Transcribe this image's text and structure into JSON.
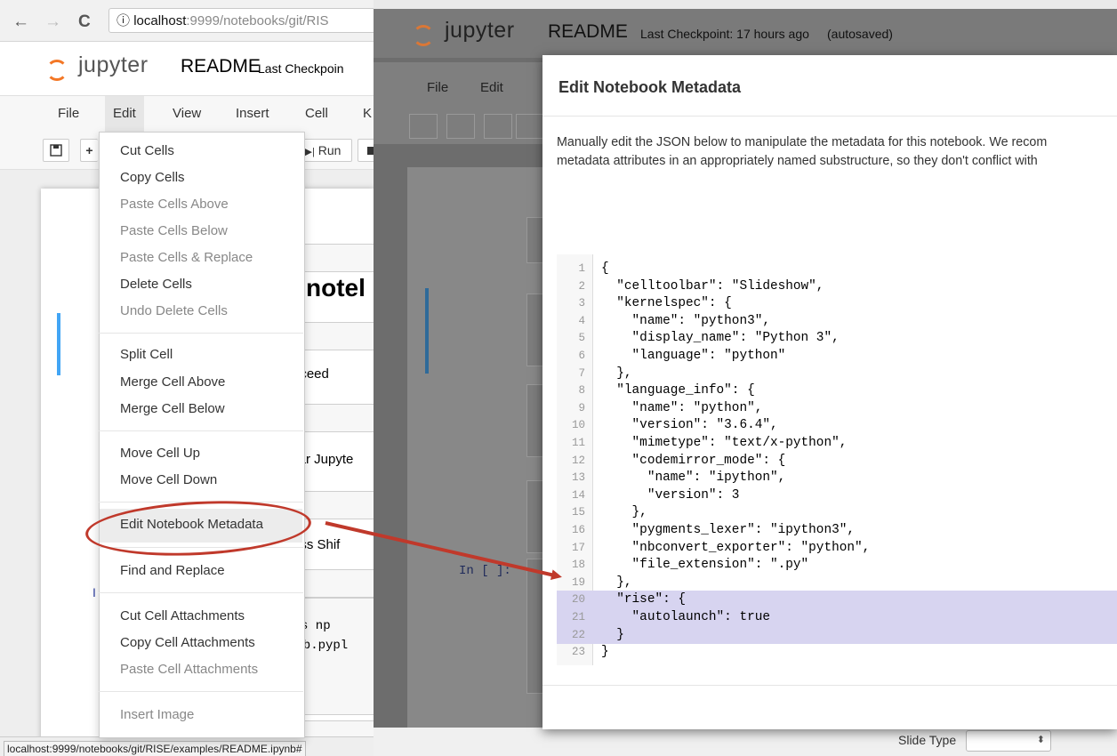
{
  "left_browser": {
    "nav": {
      "back": "←",
      "forward": "→",
      "reload": "C",
      "info": "ⓘ"
    },
    "url_host": "localhost",
    "url_rest": ":9999/notebooks/git/RIS",
    "logo_text": "jupyter",
    "notebook_name": "README",
    "checkpoint_text": "Last Checkpoin",
    "menu": [
      "File",
      "Edit",
      "View",
      "Insert",
      "Cell",
      "K"
    ],
    "toolbar": {
      "run_label": "Run"
    },
    "edit_menu": {
      "group1": [
        {
          "label": "Cut Cells",
          "enabled": true
        },
        {
          "label": "Copy Cells",
          "enabled": true
        },
        {
          "label": "Paste Cells Above",
          "enabled": false
        },
        {
          "label": "Paste Cells Below",
          "enabled": false
        },
        {
          "label": "Paste Cells & Replace",
          "enabled": false
        },
        {
          "label": "Delete Cells",
          "enabled": true
        },
        {
          "label": "Undo Delete Cells",
          "enabled": false
        }
      ],
      "group2": [
        {
          "label": "Split Cell",
          "enabled": true
        },
        {
          "label": "Merge Cell Above",
          "enabled": true
        },
        {
          "label": "Merge Cell Below",
          "enabled": true
        }
      ],
      "group3": [
        {
          "label": "Move Cell Up",
          "enabled": true
        },
        {
          "label": "Move Cell Down",
          "enabled": true
        }
      ],
      "group4": [
        {
          "label": "Edit Notebook Metadata",
          "enabled": true,
          "highlighted": true
        }
      ],
      "group5": [
        {
          "label": "Find and Replace",
          "enabled": true
        }
      ],
      "group6": [
        {
          "label": "Cut Cell Attachments",
          "enabled": true
        },
        {
          "label": "Copy Cell Attachments",
          "enabled": true
        },
        {
          "label": "Paste Cell Attachments",
          "enabled": false
        }
      ],
      "group7": [
        {
          "label": "Insert Image",
          "enabled": false
        }
      ]
    },
    "peek_text": {
      "heading": "notel",
      "proceed": "roceed",
      "jupyter": "ular Jupyte",
      "press": "ress Shif",
      "np": "s np",
      "pyplot": "lib.pypl",
      "prompt": "I"
    },
    "status_url": "localhost:9999/notebooks/git/RISE/examples/README.ipynb#"
  },
  "right_browser": {
    "logo_text": "jupyter",
    "notebook_name": "README",
    "checkpoint_text": "Last Checkpoint: 17 hours ago",
    "autosave_text": "(autosaved)",
    "menu": [
      "File",
      "Edit"
    ],
    "peek_prompt": "In [ ]:",
    "slide_type_label": "Slide Type"
  },
  "modal": {
    "title": "Edit Notebook Metadata",
    "desc_line1": "Manually edit the JSON below to manipulate the metadata for this notebook. We recom",
    "desc_line2": "metadata attributes in an appropriately named substructure, so they don't conflict with",
    "code_lines": [
      "{",
      "  \"celltoolbar\": \"Slideshow\",",
      "  \"kernelspec\": {",
      "    \"name\": \"python3\",",
      "    \"display_name\": \"Python 3\",",
      "    \"language\": \"python\"",
      "  },",
      "  \"language_info\": {",
      "    \"name\": \"python\",",
      "    \"version\": \"3.6.4\",",
      "    \"mimetype\": \"text/x-python\",",
      "    \"codemirror_mode\": {",
      "      \"name\": \"ipython\",",
      "      \"version\": 3",
      "    },",
      "    \"pygments_lexer\": \"ipython3\",",
      "    \"nbconvert_exporter\": \"python\",",
      "    \"file_extension\": \".py\"",
      "  },",
      "  \"rise\": {",
      "    \"autolaunch\": true",
      "  }",
      "}"
    ],
    "highlighted_lines": [
      20,
      21,
      22
    ]
  },
  "colors": {
    "callout": "#c0392b",
    "selection": "#d7d4f0",
    "jupyter_orange": "#f37726"
  }
}
